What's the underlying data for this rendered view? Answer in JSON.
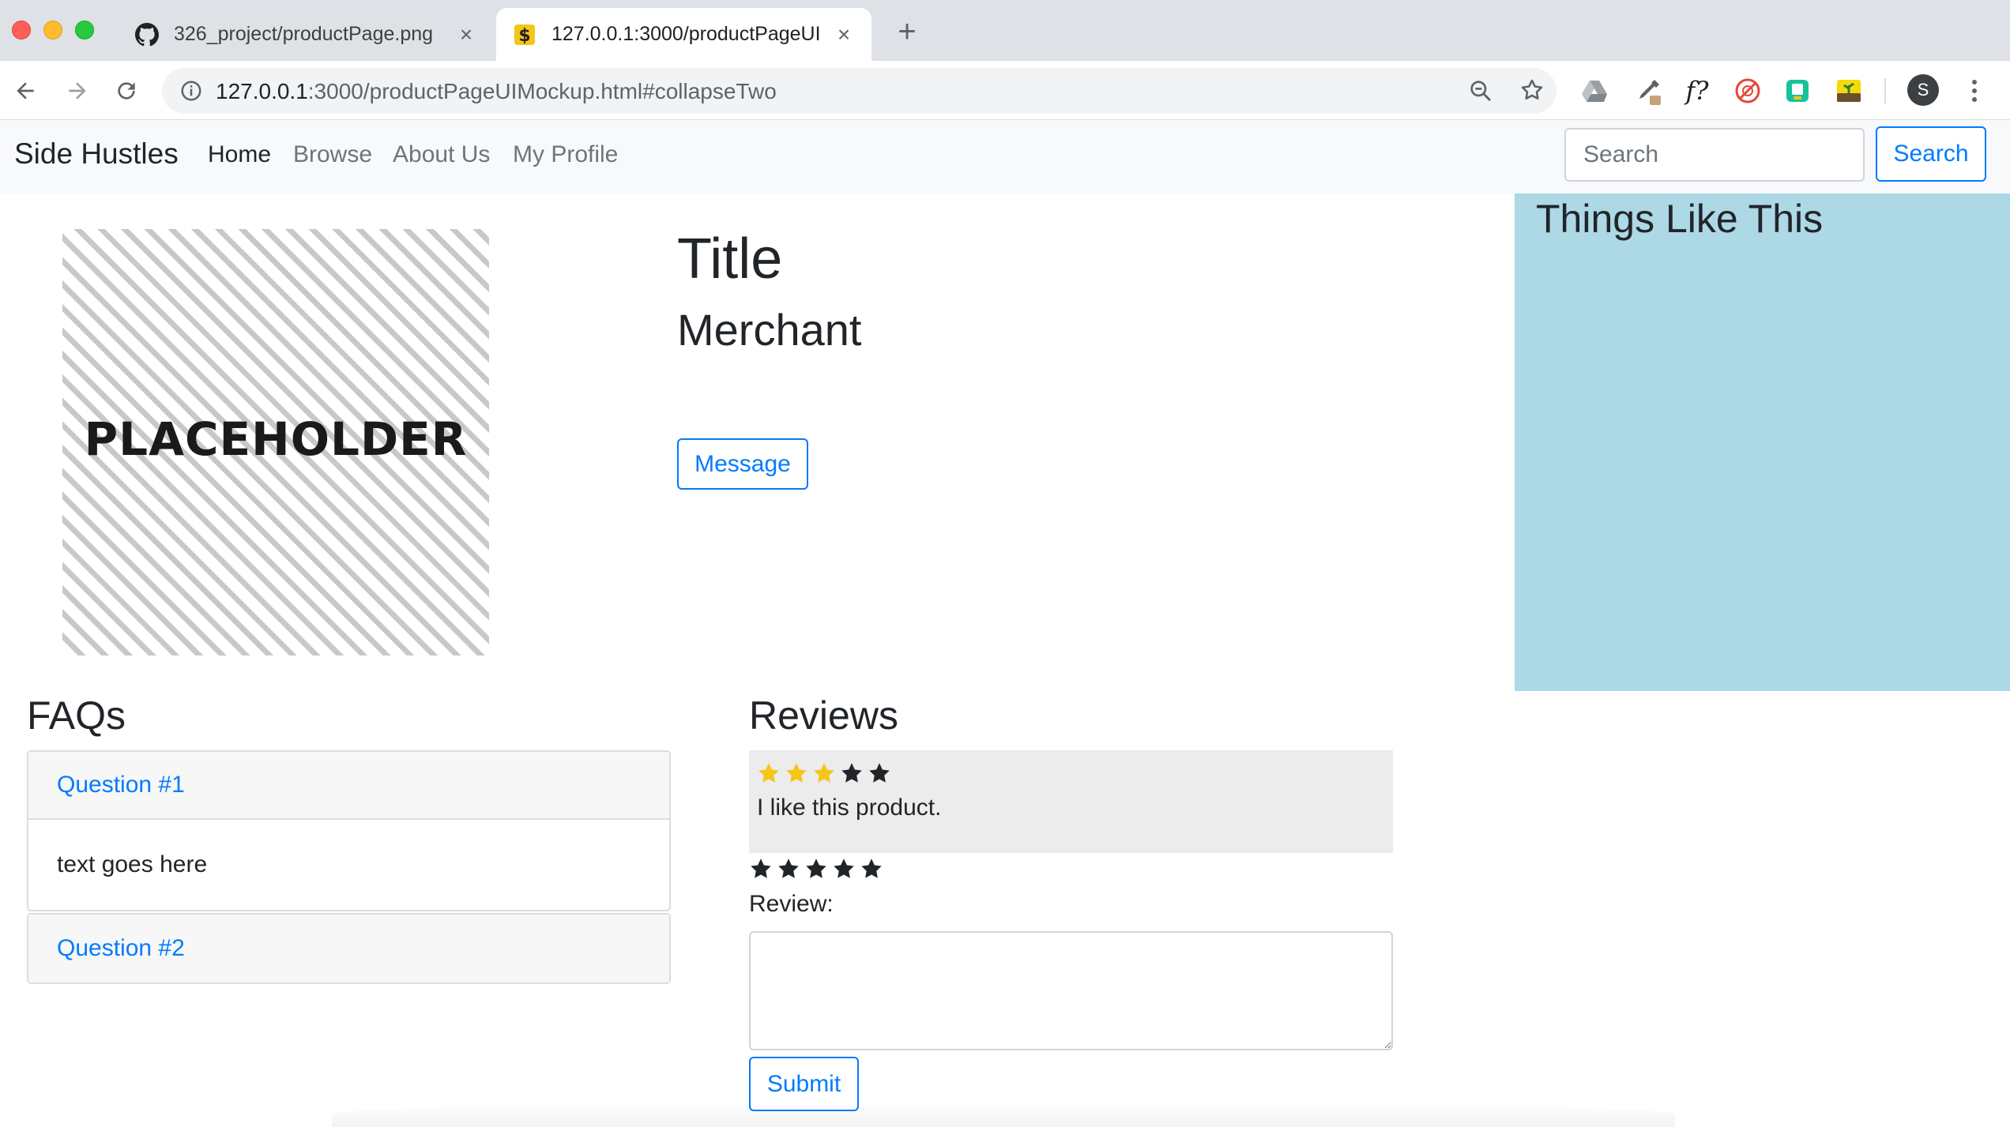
{
  "browser": {
    "tabs": [
      {
        "title": "326_project/productPage.png",
        "favicon": "github-icon",
        "active": false
      },
      {
        "title": "127.0.0.1:3000/productPageUI",
        "favicon": "site-favicon-icon",
        "active": true
      }
    ],
    "url_host": "127.0.0.1",
    "url_rest": ":3000/productPageUIMockup.html#collapseTwo",
    "avatar_letter": "S",
    "extensions": [
      "drive-icon",
      "eyedropper-icon",
      "font-finder-icon",
      "no-entry-icon",
      "grammarly-icon",
      "plant-icon"
    ]
  },
  "navbar": {
    "brand": "Side Hustles",
    "links": [
      {
        "label": "Home",
        "active": true
      },
      {
        "label": "Browse",
        "active": false
      },
      {
        "label": "About Us",
        "active": false
      },
      {
        "label": "My Profile",
        "active": false
      }
    ],
    "search_placeholder": "Search",
    "search_button": "Search"
  },
  "product": {
    "image_text": "PLACEHOLDER",
    "title": "Title",
    "merchant": "Merchant",
    "message_button": "Message"
  },
  "sidebar": {
    "title": "Things Like This",
    "background": "#add8e6"
  },
  "faqs": {
    "heading": "FAQs",
    "items": [
      {
        "question": "Question #1",
        "answer": "text goes here",
        "expanded": true
      },
      {
        "question": "Question #2",
        "answer": "",
        "expanded": false
      }
    ]
  },
  "reviews": {
    "heading": "Reviews",
    "items": [
      {
        "rating": 3,
        "max": 5,
        "text": "I like this product."
      }
    ],
    "form": {
      "rating": 0,
      "max": 5,
      "label": "Review:",
      "value": "",
      "submit_label": "Submit"
    }
  },
  "colors": {
    "accent": "#007bff",
    "star_filled": "#f5c518",
    "star_empty": "#212529",
    "navbar_bg": "#f8f9fa"
  }
}
